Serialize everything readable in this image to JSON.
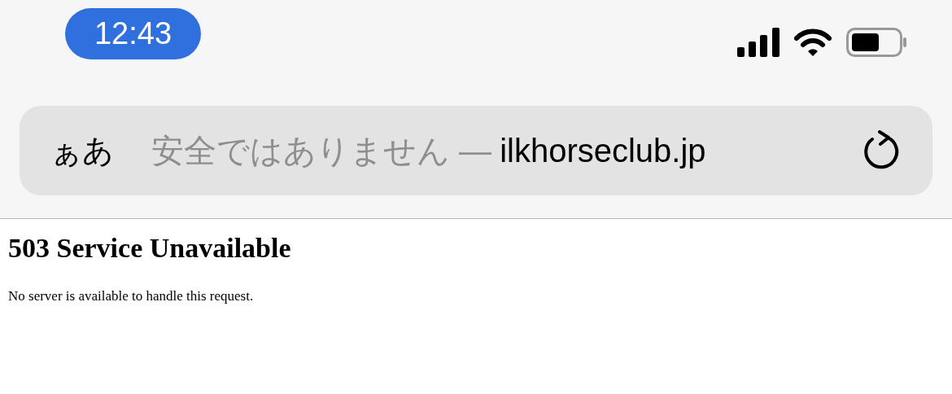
{
  "status_bar": {
    "time": "12:43"
  },
  "address_bar": {
    "reader_button": "ぁあ",
    "security_notice": "安全ではありません —",
    "url": "ilkhorseclub.jp"
  },
  "page": {
    "heading": "503 Service Unavailable",
    "message": "No server is available to handle this request."
  }
}
